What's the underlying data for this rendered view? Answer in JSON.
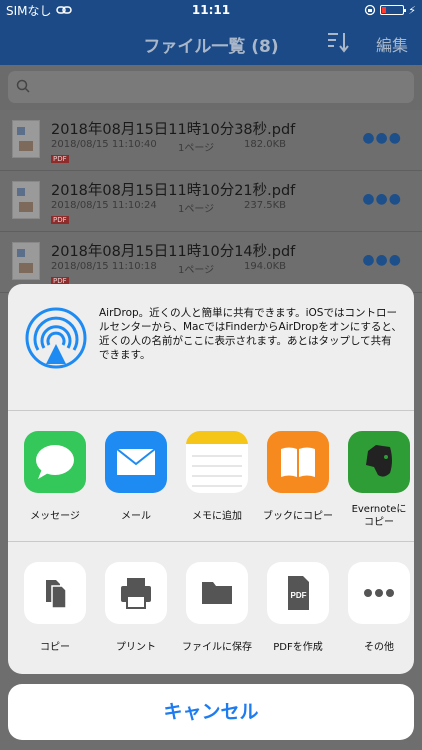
{
  "status": {
    "carrier": "SIMなし",
    "time": "11:11"
  },
  "nav": {
    "title": "ファイル一覧 (8)",
    "edit_label": "編集"
  },
  "search": {
    "placeholder": ""
  },
  "files": [
    {
      "name": "2018年08月15日11時10分38秒.pdf",
      "date": "2018/08/15 11:10:40",
      "pages": "1ページ",
      "size": "182.0KB",
      "badge": "PDF"
    },
    {
      "name": "2018年08月15日11時10分21秒.pdf",
      "date": "2018/08/15 11:10:24",
      "pages": "1ページ",
      "size": "237.5KB",
      "badge": "PDF"
    },
    {
      "name": "2018年08月15日11時10分14秒.pdf",
      "date": "2018/08/15 11:10:18",
      "pages": "1ページ",
      "size": "194.0KB",
      "badge": "PDF"
    }
  ],
  "share": {
    "airdrop_text": "AirDrop。近くの人と簡単に共有できます。iOSではコントロールセンターから、MacではFinderからAirDropをオンにすると、近くの人の名前がここに表示されます。あとはタップして共有できます。",
    "apps": [
      {
        "label": "メッセージ",
        "icon": "messages-icon"
      },
      {
        "label": "メール",
        "icon": "mail-icon"
      },
      {
        "label": "メモに追加",
        "icon": "notes-icon"
      },
      {
        "label": "ブックにコピー",
        "icon": "books-icon"
      },
      {
        "label": "Evernoteにコピー",
        "icon": "evernote-icon"
      }
    ],
    "actions": [
      {
        "label": "コピー",
        "icon": "copy-icon"
      },
      {
        "label": "プリント",
        "icon": "printer-icon"
      },
      {
        "label": "ファイルに保存",
        "icon": "folder-icon"
      },
      {
        "label": "PDFを作成",
        "icon": "pdf-file-icon",
        "icon_text": "PDF"
      },
      {
        "label": "その他",
        "icon": "more-icon"
      }
    ],
    "cancel_label": "キャンセル"
  },
  "colors": {
    "accent": "#1e7cf1",
    "nav": "#1b4a86",
    "battery_low": "#ff3b30"
  }
}
